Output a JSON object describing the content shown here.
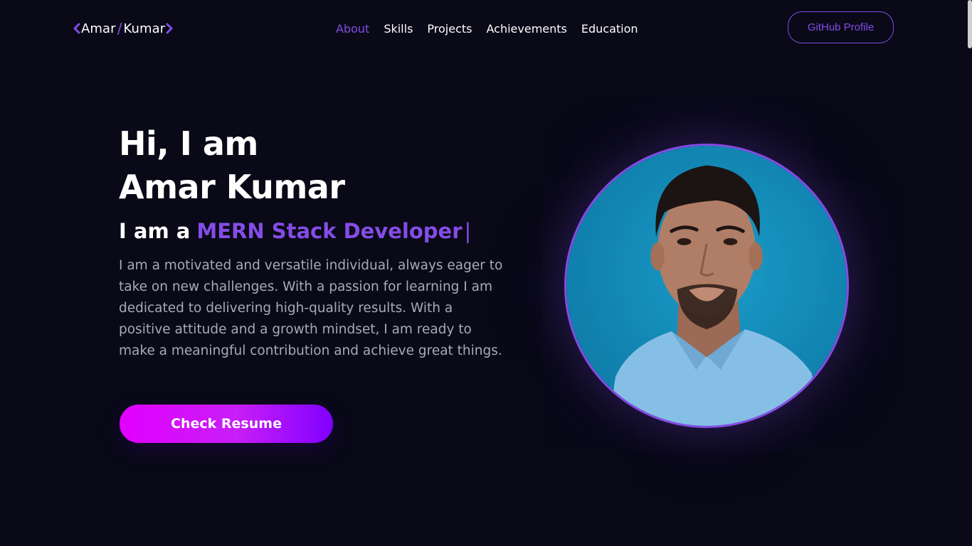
{
  "brand": {
    "first": "Amar",
    "separator": "/",
    "last": "Kumar",
    "left_icon": "chevron-left-icon",
    "right_icon": "chevron-right-icon",
    "accent_color": "#854ce6"
  },
  "nav": {
    "active": "About",
    "items": [
      {
        "label": "About"
      },
      {
        "label": "Skills"
      },
      {
        "label": "Projects"
      },
      {
        "label": "Achievements"
      },
      {
        "label": "Education"
      }
    ]
  },
  "header": {
    "github_label": "GitHub Profile"
  },
  "hero": {
    "greeting": "Hi, I am",
    "name": "Amar Kumar",
    "role_prefix": "I am a",
    "role_highlight": "MERN Stack Developer",
    "role_caret": "|",
    "bio": "I am a motivated and versatile individual, always eager to take on new challenges. With a passion for learning I am dedicated to delivering high-quality results. With a positive attitude and a growth mindset, I am ready to make a meaningful contribution and achieve great things.",
    "resume_label": "Check Resume"
  },
  "profile_image": {
    "subject": "portrait photo",
    "background_color": "#148ab5",
    "border_color": "#854ce6"
  },
  "theme": {
    "background": "#090917",
    "text_primary": "#ffffff",
    "text_secondary": "#a9a9b8",
    "accent": "#854ce6",
    "button_gradient_start": "#e100ff",
    "button_gradient_end": "#7f00ff"
  }
}
